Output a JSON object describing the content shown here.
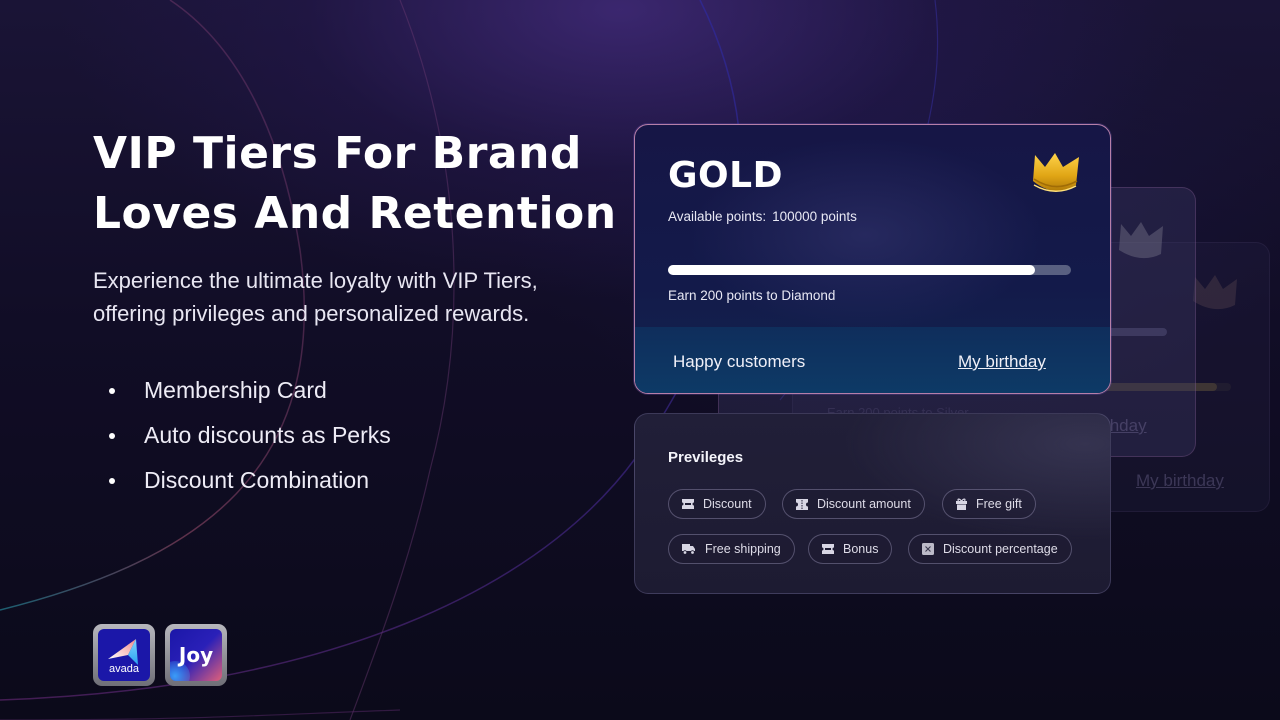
{
  "hero": {
    "title_lines": [
      "VIP Tiers For Brand",
      "Loves And Retention"
    ],
    "subtitle_lines": [
      "Experience the ultimate loyalty with VIP Tiers,",
      "offering privileges and personalized rewards."
    ],
    "bullets": [
      "Membership Card",
      "Auto discounts as Perks",
      "Discount Combination"
    ]
  },
  "logos": [
    {
      "name": "avada",
      "label": "avada"
    },
    {
      "name": "joy",
      "label": "Joy"
    }
  ],
  "tier_card": {
    "tier_name": "GOLD",
    "points_label": "Available points:",
    "points_value": "100000 points",
    "progress_fraction": 0.91,
    "earn_text": "Earn 200 points to Diamond",
    "footer_left": "Happy customers",
    "footer_link": "My birthday",
    "accent_color": "#d4a017"
  },
  "ghost_cards": {
    "faint_text": "Earn 200 points to Silver",
    "link_partial": "thday",
    "link_full": "My birthday"
  },
  "privileges": {
    "title": "Previleges",
    "items": [
      {
        "label": "Discount",
        "icon": "ticket-icon"
      },
      {
        "label": "Discount amount",
        "icon": "coupon-icon"
      },
      {
        "label": "Free gift",
        "icon": "gift-icon"
      },
      {
        "label": "Free shipping",
        "icon": "truck-icon"
      },
      {
        "label": "Bonus",
        "icon": "ticket-icon"
      },
      {
        "label": "Discount percentage",
        "icon": "percent-icon"
      }
    ]
  }
}
